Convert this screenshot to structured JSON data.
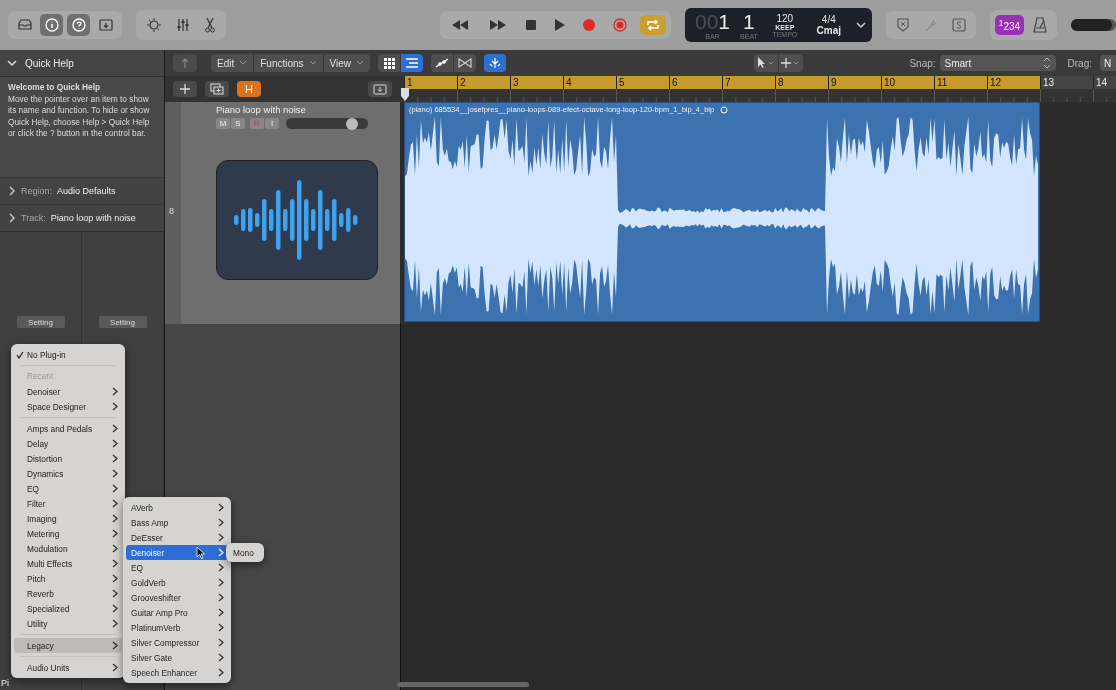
{
  "control_bar": {
    "view_toggles": [
      {
        "selected": false
      },
      {
        "selected": true
      },
      {
        "selected": true
      },
      {
        "selected": false
      }
    ],
    "cycle": {
      "on": true
    },
    "lcd": {
      "bar_prefix": "00",
      "bar": "1",
      "beat": "1",
      "bar_label": "BAR",
      "beat_label": "BEAT",
      "tempo": "120",
      "tempo_mode": "KEEP",
      "tempo_label": "TEMPO",
      "time_signature": "4/4",
      "key": "Cmaj"
    },
    "count_in": {
      "label": "$^{1}$234",
      "on": true
    },
    "master_volume": {
      "level": 0.9
    }
  },
  "quick_help": {
    "title": "Quick Help",
    "heading": "Welcome to Quick Help",
    "body": "Move the pointer over an item to show its name and function. To hide or show Quick Help, choose Help > Quick Help or click the ? button in the control bar."
  },
  "inspector_sections": [
    {
      "label": "Region:",
      "value": "Audio Defaults"
    },
    {
      "label": "Track:",
      "value": "Piano loop with noise"
    }
  ],
  "channel_buttons": [
    "Setting",
    "Setting"
  ],
  "tracks_toolbar": {
    "menus": [
      "Edit",
      "Functions",
      "View"
    ],
    "snap_label": "Snap:",
    "snap_value": "Smart",
    "drag_label": "Drag:",
    "drag_value": "N"
  },
  "hide_button": {
    "label": "H",
    "on": true
  },
  "track": {
    "number": "8",
    "name": "Piano loop with noise",
    "level": 0.8,
    "buttons": [
      {
        "label": "M",
        "kind": "mute"
      },
      {
        "label": "S",
        "kind": "solo"
      },
      {
        "label": "R",
        "kind": "record"
      },
      {
        "label": "I",
        "kind": "input"
      }
    ]
  },
  "ruler": [
    {
      "label": "1",
      "in_cycle": true
    },
    {
      "label": "2",
      "in_cycle": true
    },
    {
      "label": "3",
      "in_cycle": true
    },
    {
      "label": "4",
      "in_cycle": true
    },
    {
      "label": "5",
      "in_cycle": true
    },
    {
      "label": "6",
      "in_cycle": true
    },
    {
      "label": "7",
      "in_cycle": true
    },
    {
      "label": "8",
      "in_cycle": true
    },
    {
      "label": "9",
      "in_cycle": true
    },
    {
      "label": "10",
      "in_cycle": true
    },
    {
      "label": "11",
      "in_cycle": true
    },
    {
      "label": "12",
      "in_cycle": true
    },
    {
      "label": "13",
      "in_cycle": false
    },
    {
      "label": "14",
      "in_cycle": false
    }
  ],
  "region": {
    "name": "(piano) 685534__josefpres__piano-loops-089-efect-octave-long-loop-120-bpm_1_bip_4_bip"
  },
  "bottom_fragment": "Pi",
  "plugin_menu": [
    {
      "kind": "item",
      "label": "No Plug-in",
      "checked": true,
      "selected": false,
      "submenu": false
    },
    {
      "kind": "separator"
    },
    {
      "kind": "header",
      "label": "Recent"
    },
    {
      "kind": "item",
      "label": "Denoiser",
      "checked": false,
      "selected": false,
      "submenu": true
    },
    {
      "kind": "item",
      "label": "Space Designer",
      "checked": false,
      "selected": false,
      "submenu": true
    },
    {
      "kind": "separator"
    },
    {
      "kind": "item",
      "label": "Amps and Pedals",
      "checked": false,
      "selected": false,
      "submenu": true
    },
    {
      "kind": "item",
      "label": "Delay",
      "checked": false,
      "selected": false,
      "submenu": true
    },
    {
      "kind": "item",
      "label": "Distortion",
      "checked": false,
      "selected": false,
      "submenu": true
    },
    {
      "kind": "item",
      "label": "Dynamics",
      "checked": false,
      "selected": false,
      "submenu": true
    },
    {
      "kind": "item",
      "label": "EQ",
      "checked": false,
      "selected": false,
      "submenu": true
    },
    {
      "kind": "item",
      "label": "Filter",
      "checked": false,
      "selected": false,
      "submenu": true
    },
    {
      "kind": "item",
      "label": "Imaging",
      "checked": false,
      "selected": false,
      "submenu": true
    },
    {
      "kind": "item",
      "label": "Metering",
      "checked": false,
      "selected": false,
      "submenu": true
    },
    {
      "kind": "item",
      "label": "Modulation",
      "checked": false,
      "selected": false,
      "submenu": true
    },
    {
      "kind": "item",
      "label": "Multi Effects",
      "checked": false,
      "selected": false,
      "submenu": true
    },
    {
      "kind": "item",
      "label": "Pitch",
      "checked": false,
      "selected": false,
      "submenu": true
    },
    {
      "kind": "item",
      "label": "Reverb",
      "checked": false,
      "selected": false,
      "submenu": true
    },
    {
      "kind": "item",
      "label": "Specialized",
      "checked": false,
      "selected": false,
      "submenu": true
    },
    {
      "kind": "item",
      "label": "Utility",
      "checked": false,
      "selected": false,
      "submenu": true
    },
    {
      "kind": "separator"
    },
    {
      "kind": "item",
      "label": "Legacy",
      "checked": false,
      "selected": true,
      "submenu": true
    },
    {
      "kind": "separator"
    },
    {
      "kind": "item",
      "label": "Audio Units",
      "checked": false,
      "selected": false,
      "submenu": true
    }
  ],
  "legacy_menu": [
    {
      "label": "AVerb",
      "selected": false,
      "submenu": true
    },
    {
      "label": "Bass Amp",
      "selected": false,
      "submenu": true
    },
    {
      "label": "DeEsser",
      "selected": false,
      "submenu": true
    },
    {
      "label": "Denoiser",
      "selected": true,
      "submenu": true
    },
    {
      "label": "EQ",
      "selected": false,
      "submenu": true
    },
    {
      "label": "GoldVerb",
      "selected": false,
      "submenu": true
    },
    {
      "label": "Grooveshifter",
      "selected": false,
      "submenu": true
    },
    {
      "label": "Guitar Amp Pro",
      "selected": false,
      "submenu": true
    },
    {
      "label": "PlatinumVerb",
      "selected": false,
      "submenu": true
    },
    {
      "label": "Silver Compressor",
      "selected": false,
      "submenu": true
    },
    {
      "label": "Silver Gate",
      "selected": false,
      "submenu": true
    },
    {
      "label": "Speech Enhancer",
      "selected": false,
      "submenu": true
    }
  ],
  "denoiser_menu": [
    {
      "label": "Mono",
      "selected": false
    }
  ]
}
